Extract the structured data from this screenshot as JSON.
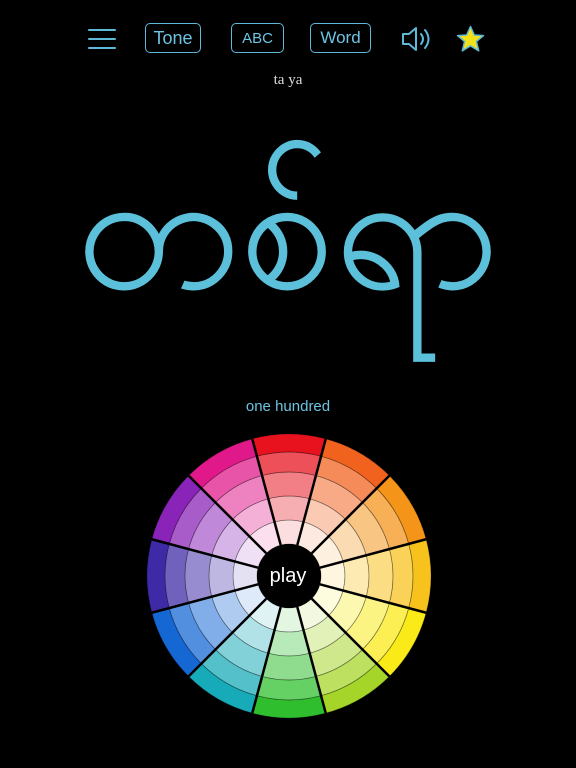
{
  "toolbar": {
    "menu_icon": "hamburger-menu-icon",
    "tone_label": "Tone",
    "abc_label": "ABC",
    "word_label": "Word",
    "speaker_icon": "speaker-icon",
    "star_icon": "star-icon"
  },
  "word": {
    "romanization": "ta ya",
    "script": "တစ်ရာ",
    "meaning": "one hundred"
  },
  "wheel": {
    "play_label": "play",
    "hues": [
      "#e8121e",
      "#f2621f",
      "#f49419",
      "#f7c21c",
      "#f9ea18",
      "#a6d52a",
      "#2fbf2e",
      "#17aab8",
      "#1567d4",
      "#3e2aa6",
      "#8a23b8",
      "#e0188a"
    ]
  },
  "colors": {
    "accent": "#5cc0da",
    "background": "#000000",
    "star": "#f2e21a"
  }
}
